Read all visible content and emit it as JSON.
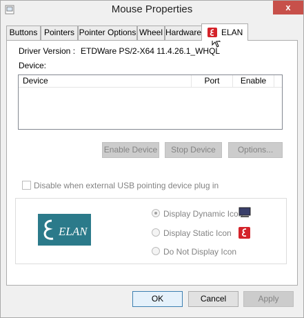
{
  "window": {
    "title": "Mouse Properties",
    "close_label": "x"
  },
  "tabs": [
    {
      "label": "Buttons"
    },
    {
      "label": "Pointers"
    },
    {
      "label": "Pointer Options"
    },
    {
      "label": "Wheel"
    },
    {
      "label": "Hardware"
    },
    {
      "label": "ELAN",
      "active": true
    }
  ],
  "elan": {
    "driver_version_label": "Driver Version :",
    "driver_version_value": "ETDWare PS/2-X64 11.4.26.1_WHQL",
    "device_label": "Device:",
    "list_columns": [
      "Device",
      "Port",
      "Enable"
    ],
    "buttons": {
      "enable_device": "Enable Device",
      "stop_device": "Stop Device",
      "options": "Options..."
    },
    "disable_usb_label": "Disable when external USB pointing device plug in",
    "logo_text": "ELAN",
    "icon_options": [
      {
        "label": "Display Dynamic Icon",
        "selected": true
      },
      {
        "label": "Display Static Icon",
        "selected": false
      },
      {
        "label": "Do Not Display Icon",
        "selected": false
      }
    ]
  },
  "footer": {
    "ok": "OK",
    "cancel": "Cancel",
    "apply": "Apply"
  },
  "colors": {
    "close_button": "#c7504a",
    "logo_teal": "#2b7a8a",
    "elan_red": "#d4232a"
  }
}
